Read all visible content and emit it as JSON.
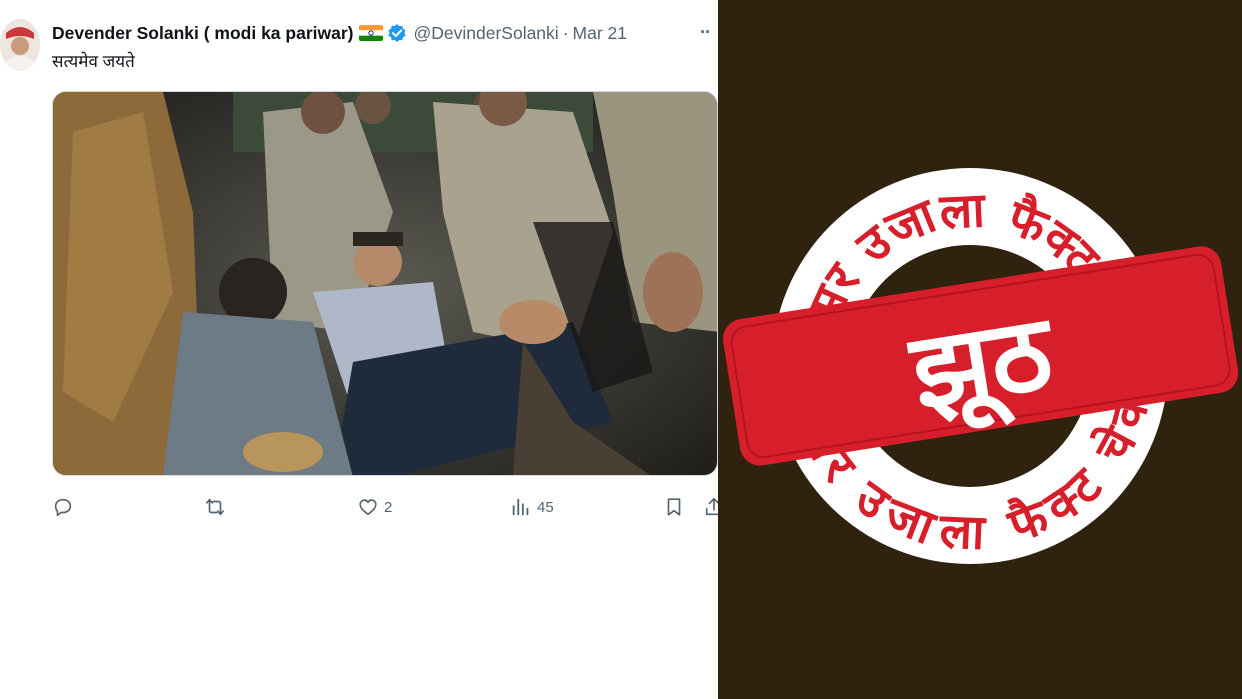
{
  "tweet": {
    "author_name": "Devender Solanki ( modi ka pariwar)",
    "handle": "@DevinderSolanki",
    "separator": "·",
    "date": "Mar 21",
    "more_label": "··",
    "text": "सत्यमेव जयते",
    "flag_icon": "india-flag-icon",
    "verified_icon": "verified-badge-icon",
    "actions": {
      "reply": {
        "icon": "reply-icon",
        "count": ""
      },
      "retweet": {
        "icon": "retweet-icon",
        "count": ""
      },
      "like": {
        "icon": "heart-icon",
        "count": "2"
      },
      "views": {
        "icon": "views-chart-icon",
        "count": "45"
      },
      "bookmark": {
        "icon": "bookmark-icon"
      },
      "share": {
        "icon": "share-icon"
      }
    }
  },
  "stamp": {
    "top_arc_text": "अमर उजाला फैक्ट चेक",
    "bottom_arc_text": "अमर उजाला फैक्ट चेक",
    "verdict": "झूठ",
    "colors": {
      "red": "#d71f2b",
      "background": "#2f2310",
      "ring": "#ffffff"
    }
  }
}
